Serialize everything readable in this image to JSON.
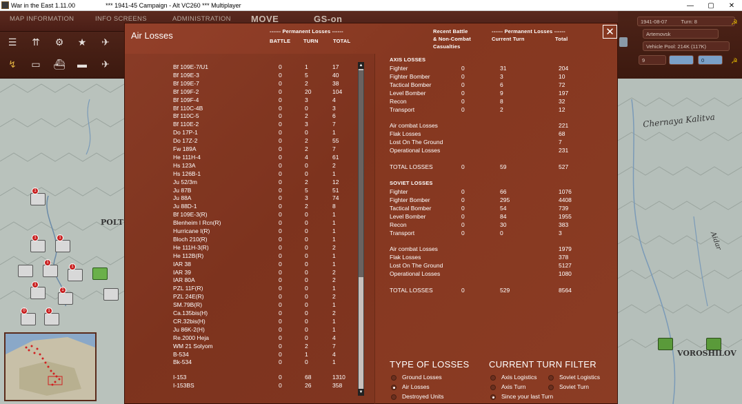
{
  "titlebar": {
    "app_title": "War in the East 1.11.00",
    "window_title": "***   1941-45 Campaign - Alt VC260   ***   Multiplayer",
    "minimize": "—",
    "maximize": "▢",
    "close": "✕"
  },
  "topbar": {
    "tabs": [
      "MAP INFORMATION",
      "INFO SCREENS",
      "ADMINISTRATION"
    ],
    "mode": "MOVE",
    "gs": "GS-on"
  },
  "right_info": {
    "date": "1941-08-07",
    "turn": "Turn: 8",
    "location": "Artemovsk",
    "vehicle_pool": "Vehicle Pool: 214K (117K)",
    "val_a": "9",
    "val_b": "0"
  },
  "map": {
    "labels": [
      "POLT",
      "Chernaya Kalitva",
      "Aidar",
      "VOROSHILOV"
    ]
  },
  "dialog": {
    "title": "Air Losses",
    "close_label": "✕",
    "left_headers": {
      "group": "------ Permanent Losses ------",
      "battle": "BATTLE",
      "turn": "TURN",
      "total": "TOTAL"
    },
    "right_headers": {
      "recent": "Recent Battle",
      "noncombat": "& Non-Combat",
      "casualties": "Casualties",
      "group": "------ Permanent Losses ------",
      "current_turn": "Current Turn",
      "total": "Total"
    },
    "aircraft": [
      [
        "Bf 109E-7/U1",
        "0",
        "1",
        "17"
      ],
      [
        "Bf 109E-3",
        "0",
        "5",
        "40"
      ],
      [
        "Bf 109E-7",
        "0",
        "2",
        "38"
      ],
      [
        "Bf 109F-2",
        "0",
        "20",
        "104"
      ],
      [
        "Bf 109F-4",
        "0",
        "3",
        "4"
      ],
      [
        "Bf 110C-4B",
        "0",
        "0",
        "3"
      ],
      [
        "Bf 110C-5",
        "0",
        "2",
        "6"
      ],
      [
        "Bf 110E-2",
        "0",
        "3",
        "7"
      ],
      [
        "Do 17P-1",
        "0",
        "0",
        "1"
      ],
      [
        "Do 17Z-2",
        "0",
        "2",
        "55"
      ],
      [
        "Fw 189A",
        "0",
        "2",
        "7"
      ],
      [
        "He 111H-4",
        "0",
        "4",
        "61"
      ],
      [
        "Hs 123A",
        "0",
        "0",
        "2"
      ],
      [
        "Hs 126B-1",
        "0",
        "0",
        "1"
      ],
      [
        "Ju 52/3m",
        "0",
        "2",
        "12"
      ],
      [
        "Ju 87B",
        "0",
        "5",
        "51"
      ],
      [
        "Ju 88A",
        "0",
        "3",
        "74"
      ],
      [
        "Ju 88D-1",
        "0",
        "2",
        "8"
      ],
      [
        "Bf 109E-3(R)",
        "0",
        "0",
        "1"
      ],
      [
        "Blenheim I Rcn(R)",
        "0",
        "0",
        "1"
      ],
      [
        "Hurricane I(R)",
        "0",
        "0",
        "1"
      ],
      [
        "Bloch 210(R)",
        "0",
        "0",
        "1"
      ],
      [
        "He 111H-3(R)",
        "0",
        "0",
        "2"
      ],
      [
        "He 112B(R)",
        "0",
        "0",
        "1"
      ],
      [
        "IAR 38",
        "0",
        "0",
        "1"
      ],
      [
        "IAR 39",
        "0",
        "0",
        "2"
      ],
      [
        "IAR 80A",
        "0",
        "0",
        "2"
      ],
      [
        "PZL 11F(R)",
        "0",
        "0",
        "1"
      ],
      [
        "PZL 24E(R)",
        "0",
        "0",
        "2"
      ],
      [
        "SM.79B(R)",
        "0",
        "0",
        "1"
      ],
      [
        "Ca.135bis(H)",
        "0",
        "0",
        "2"
      ],
      [
        "CR.32bis(H)",
        "0",
        "0",
        "1"
      ],
      [
        "Ju 86K-2(H)",
        "0",
        "0",
        "1"
      ],
      [
        "Re.2000 Heja",
        "0",
        "0",
        "4"
      ],
      [
        "WM 21 Solyom",
        "0",
        "2",
        "7"
      ],
      [
        "B-534",
        "0",
        "1",
        "4"
      ],
      [
        "Bk-534",
        "0",
        "0",
        "1"
      ]
    ],
    "soviet_aircraft": [
      [
        "I-153",
        "0",
        "68",
        "1310"
      ],
      [
        "I-153BS",
        "0",
        "26",
        "358"
      ]
    ],
    "axis": {
      "title": "AXIS LOSSES",
      "types": [
        [
          "Fighter",
          "0",
          "31",
          "204"
        ],
        [
          "Fighter Bomber",
          "0",
          "3",
          "10"
        ],
        [
          "Tactical Bomber",
          "0",
          "6",
          "72"
        ],
        [
          "Level Bomber",
          "0",
          "9",
          "197"
        ],
        [
          "Recon",
          "0",
          "8",
          "32"
        ],
        [
          "Transport",
          "0",
          "2",
          "12"
        ]
      ],
      "causes": [
        [
          "Air combat Losses",
          "221"
        ],
        [
          "Flak Losses",
          "68"
        ],
        [
          "Lost On The Ground",
          "7"
        ],
        [
          "Operational Losses",
          "231"
        ]
      ],
      "total": [
        "TOTAL LOSSES",
        "0",
        "59",
        "527"
      ]
    },
    "soviet": {
      "title": "SOVIET LOSSES",
      "types": [
        [
          "Fighter",
          "0",
          "66",
          "1076"
        ],
        [
          "Fighter Bomber",
          "0",
          "295",
          "4408"
        ],
        [
          "Tactical Bomber",
          "0",
          "54",
          "739"
        ],
        [
          "Level Bomber",
          "0",
          "84",
          "1955"
        ],
        [
          "Recon",
          "0",
          "30",
          "383"
        ],
        [
          "Transport",
          "0",
          "0",
          "3"
        ]
      ],
      "causes": [
        [
          "Air combat Losses",
          "1979"
        ],
        [
          "Flak Losses",
          "378"
        ],
        [
          "Lost On The Ground",
          "5127"
        ],
        [
          "Operational Losses",
          "1080"
        ]
      ],
      "total": [
        "TOTAL LOSSES",
        "0",
        "529",
        "8564"
      ]
    },
    "type_of_losses": {
      "title": "TYPE OF LOSSES",
      "options": [
        "Ground Losses",
        "Air Losses",
        "Destroyed Units"
      ],
      "selected": 1
    },
    "turn_filter": {
      "title": "CURRENT TURN FILTER",
      "options": [
        "Axis Logistics",
        "Soviet Logistics",
        "Axis Turn",
        "Soviet Turn",
        "Since your last Turn"
      ],
      "selected": 4
    }
  }
}
